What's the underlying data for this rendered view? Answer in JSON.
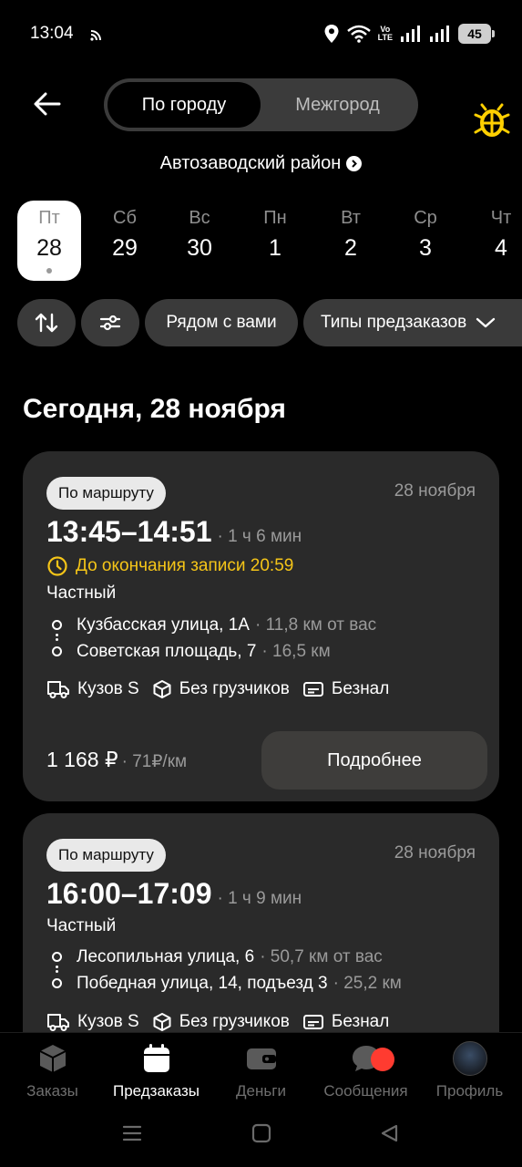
{
  "status_bar": {
    "time": "13:04",
    "volte_top": "Vo",
    "volte_bottom": "LTE",
    "battery": "45"
  },
  "header": {
    "tabs": [
      {
        "label": "По городу",
        "active": true
      },
      {
        "label": "Межгород",
        "active": false
      }
    ]
  },
  "district": "Автозаводский район",
  "days": [
    {
      "dow": "Пт",
      "num": "28",
      "selected": true
    },
    {
      "dow": "Сб",
      "num": "29"
    },
    {
      "dow": "Вс",
      "num": "30"
    },
    {
      "dow": "Пн",
      "num": "1"
    },
    {
      "dow": "Вт",
      "num": "2"
    },
    {
      "dow": "Ср",
      "num": "3"
    },
    {
      "dow": "Чт",
      "num": "4"
    }
  ],
  "filters": {
    "nearby": "Рядом с вами",
    "types": "Типы предзаказов"
  },
  "section_title": "Сегодня, 28 ноября",
  "orders": [
    {
      "badge": "По маршруту",
      "date": "28 ноября",
      "time_range": "13:45–14:51",
      "duration": "· 1 ч 6 мин",
      "deadline": "До окончания записи 20:59",
      "kind": "Частный",
      "from": "Кузбасская улица, 1А",
      "from_dist": "· 11,8 км от вас",
      "to": "Советская площадь, 7",
      "to_dist": "· 16,5 км",
      "body": "Кузов S",
      "loaders": "Без грузчиков",
      "payment": "Безнал",
      "price": "1 168 ₽",
      "per_km": "· 71₽/км",
      "details_label": "Подробнее"
    },
    {
      "badge": "По маршруту",
      "date": "28 ноября",
      "time_range": "16:00–17:09",
      "duration": "· 1 ч 9 мин",
      "kind": "Частный",
      "from": "Лесопильная улица, 6",
      "from_dist": "· 50,7 км от вас",
      "to": "Победная улица, 14, подъезд 3",
      "to_dist": "· 25,2 км",
      "body": "Кузов S",
      "loaders": "Без грузчиков",
      "payment": "Безнал"
    }
  ],
  "bottom_nav": [
    {
      "label": "Заказы",
      "icon": "orders-cube-icon"
    },
    {
      "label": "Предзаказы",
      "icon": "calendar-icon",
      "active": true
    },
    {
      "label": "Деньги",
      "icon": "wallet-icon"
    },
    {
      "label": "Сообщения",
      "icon": "chat-icon",
      "badge": true
    },
    {
      "label": "Профиль",
      "icon": "avatar"
    }
  ],
  "colors": {
    "background": "#000000",
    "card": "#2a2a2a",
    "chip": "#3a3a3a",
    "deadline_accent": "#f5c518",
    "muted_text": "#9a9a9a",
    "notification": "#ff3b30",
    "bug_icon": "#ffd000"
  }
}
